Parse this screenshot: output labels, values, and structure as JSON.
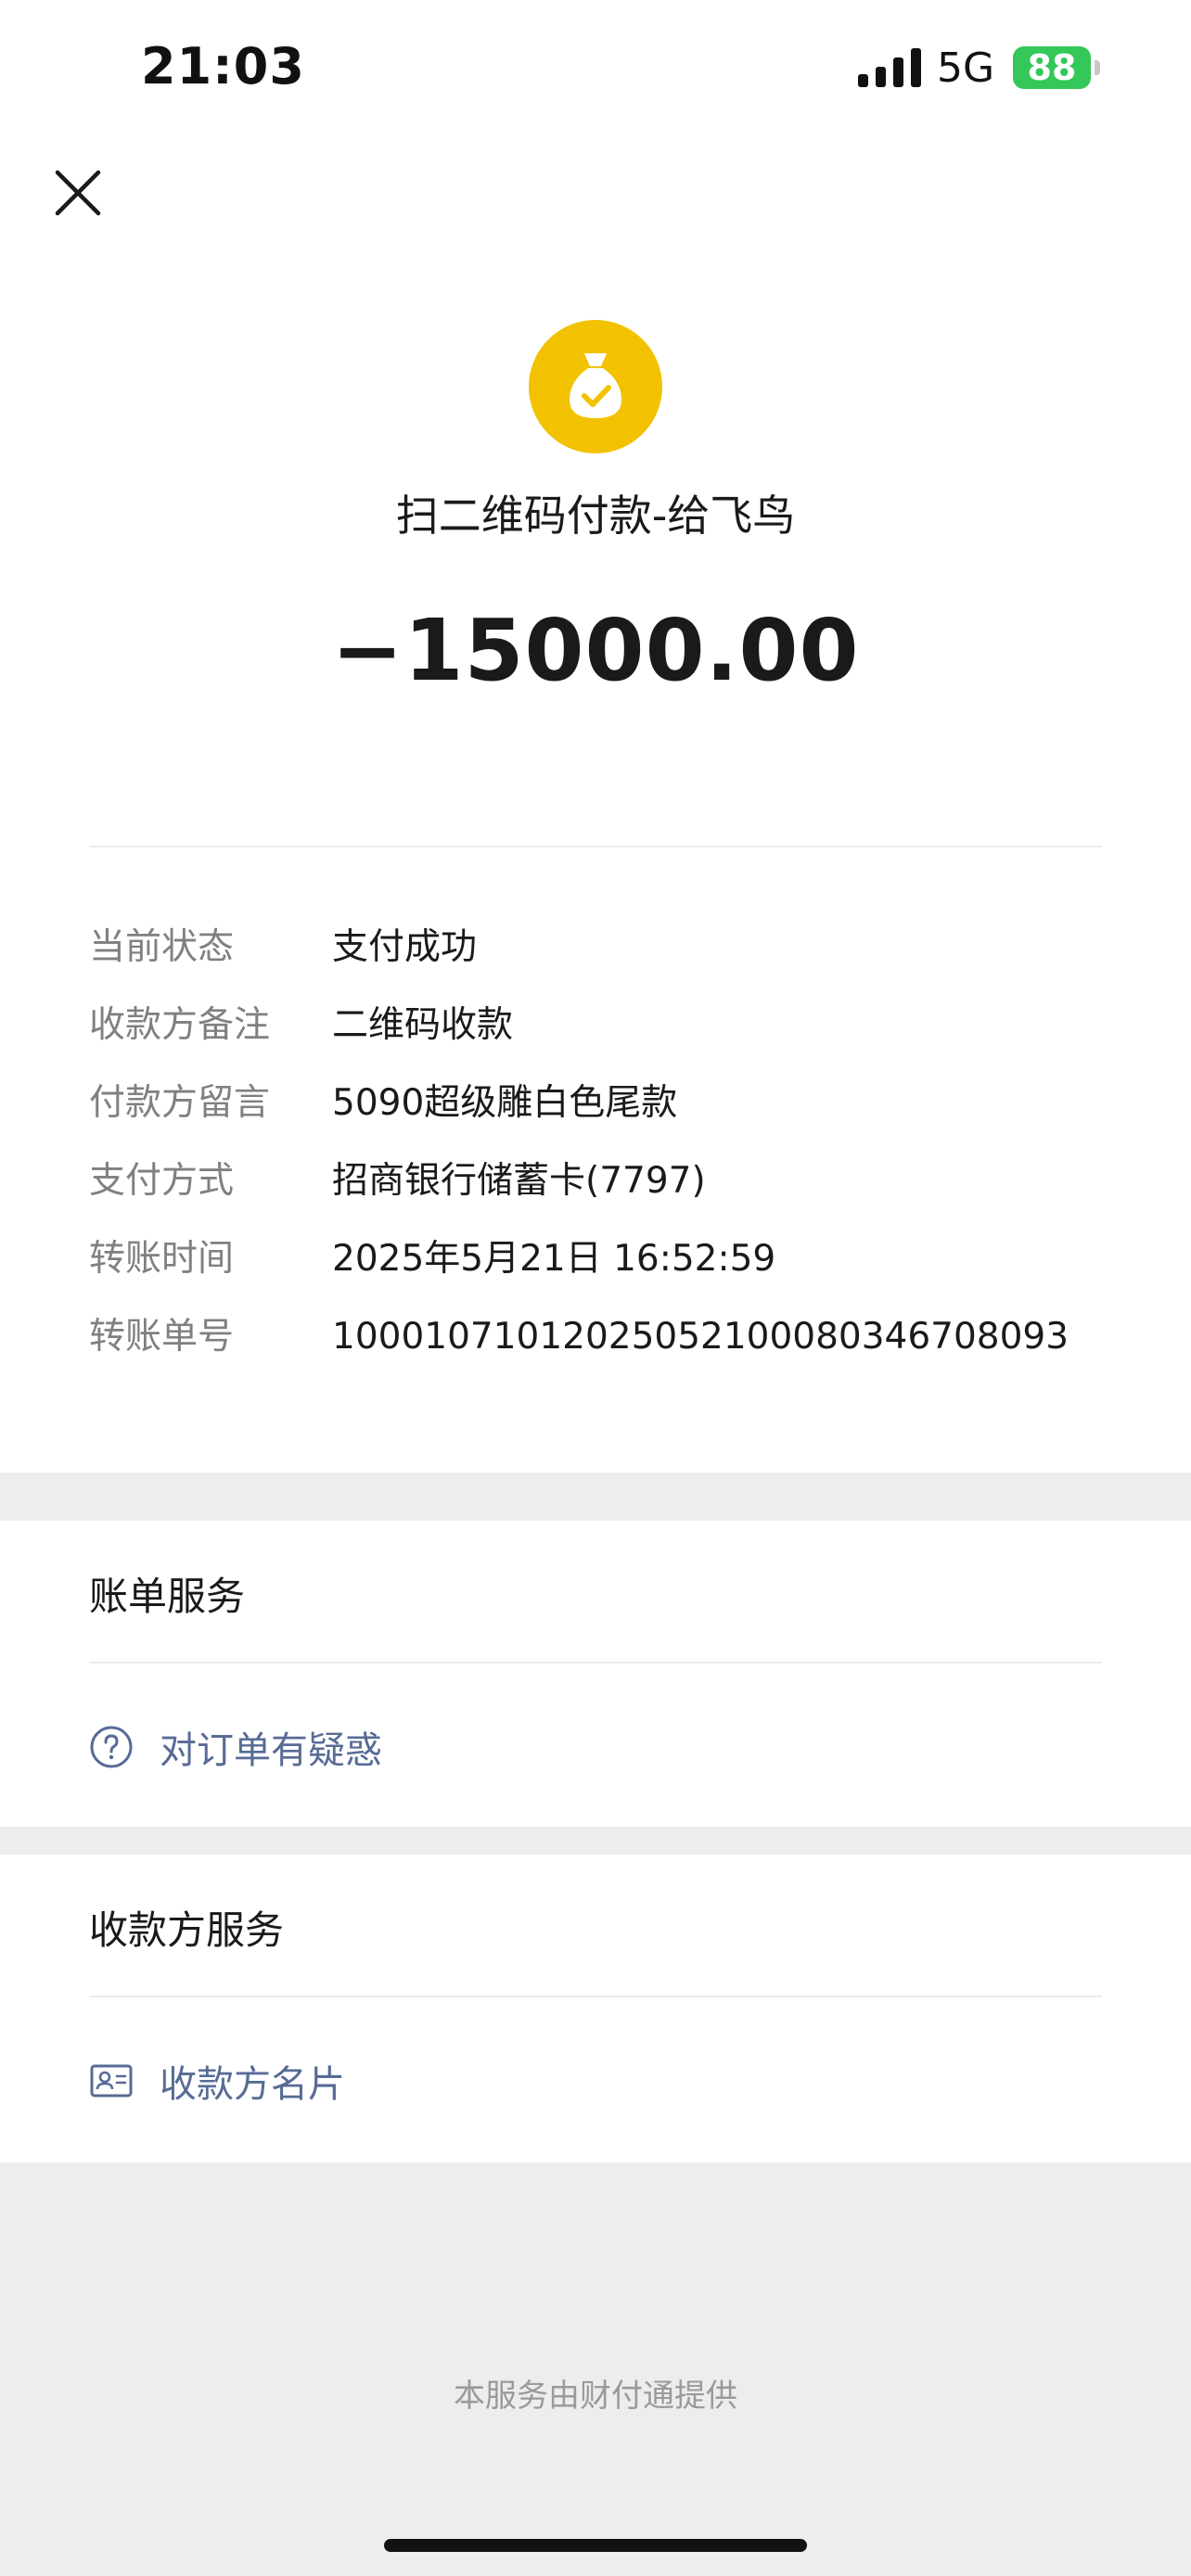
{
  "status_bar": {
    "time": "21:03",
    "network": "5G",
    "battery": "88",
    "icons": [
      "signal-icon",
      "battery-icon"
    ]
  },
  "header": {
    "close_icon": "close-icon",
    "payment_icon": "money-bag-check-icon",
    "title": "扫二维码付款-给飞鸟",
    "amount": "−15000.00"
  },
  "details": [
    {
      "label": "当前状态",
      "value": "支付成功"
    },
    {
      "label": "收款方备注",
      "value": "二维码收款"
    },
    {
      "label": "付款方留言",
      "value": "5090超级雕白色尾款"
    },
    {
      "label": "支付方式",
      "value": "招商银行储蓄卡(7797)"
    },
    {
      "label": "转账时间",
      "value": "2025年5月21日 16:52:59"
    },
    {
      "label": "转账单号",
      "value": "10001071012025052100080346708093"
    }
  ],
  "bill_service": {
    "title": "账单服务",
    "link_label": "对订单有疑惑",
    "link_icon": "question-circle-icon"
  },
  "payee_service": {
    "title": "收款方服务",
    "link_label": "收款方名片",
    "link_icon": "contact-card-icon"
  },
  "footer": "本服务由财付通提供",
  "colors": {
    "accent_yellow": "#f2c200",
    "link_blue": "#576b95",
    "battery_green": "#34c759",
    "page_gray": "#ededed"
  }
}
